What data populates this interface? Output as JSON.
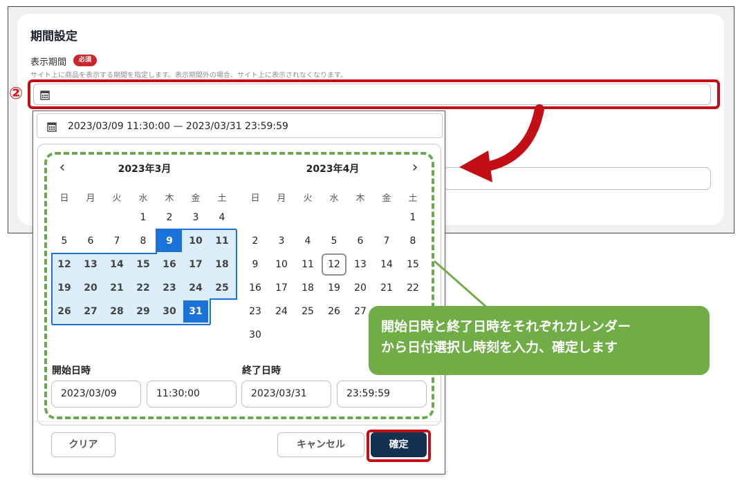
{
  "section": {
    "title": "期間設定",
    "field_label": "表示期間",
    "required_badge": "必須",
    "hint": "サイト上に商品を表示する期間を指定します。表示期間外の場合、サイト上に表示されなくなります。",
    "step_marker": "②"
  },
  "popup": {
    "range_text": "2023/03/09 11:30:00 — 2023/03/31 23:59:59",
    "left_month": "2023年3月",
    "right_month": "2023年4月",
    "weekdays": [
      "日",
      "月",
      "火",
      "水",
      "木",
      "金",
      "土"
    ],
    "start_label": "開始日時",
    "end_label": "終了日時",
    "start_date": "2023/03/09",
    "start_time": "11:30:00",
    "end_date": "2023/03/31",
    "end_time": "23:59:59",
    "clear_label": "クリア",
    "cancel_label": "キャンセル",
    "confirm_label": "確定"
  },
  "calendar_march": {
    "rows": [
      [
        "",
        "",
        "",
        "1",
        "2",
        "3",
        "4"
      ],
      [
        "5",
        "6",
        "7",
        "8",
        "9",
        "10",
        "11"
      ],
      [
        "12",
        "13",
        "14",
        "15",
        "16",
        "17",
        "18"
      ],
      [
        "19",
        "20",
        "21",
        "22",
        "23",
        "24",
        "25"
      ],
      [
        "26",
        "27",
        "28",
        "29",
        "30",
        "31",
        ""
      ]
    ],
    "range_start": "9",
    "range_end": "31"
  },
  "calendar_april": {
    "rows": [
      [
        "",
        "",
        "",
        "",
        "",
        "",
        "1"
      ],
      [
        "2",
        "3",
        "4",
        "5",
        "6",
        "7",
        "8"
      ],
      [
        "9",
        "10",
        "11",
        "12",
        "13",
        "14",
        "15"
      ],
      [
        "16",
        "17",
        "18",
        "19",
        "20",
        "21",
        "22"
      ],
      [
        "23",
        "24",
        "25",
        "26",
        "27",
        "",
        ""
      ],
      [
        "30",
        "",
        "",
        "",
        "",
        "",
        ""
      ]
    ],
    "today": "12"
  },
  "callout": {
    "line1": "開始日時と終了日時をそれぞれカレンダー",
    "line2": "から日付選択し時刻を入力、確定します"
  },
  "colors": {
    "selected": "#1b73d9",
    "range": "#dbeef9",
    "highlight_red": "#c40e15",
    "callout_green": "#70ad47",
    "confirm_button": "#12304f"
  }
}
